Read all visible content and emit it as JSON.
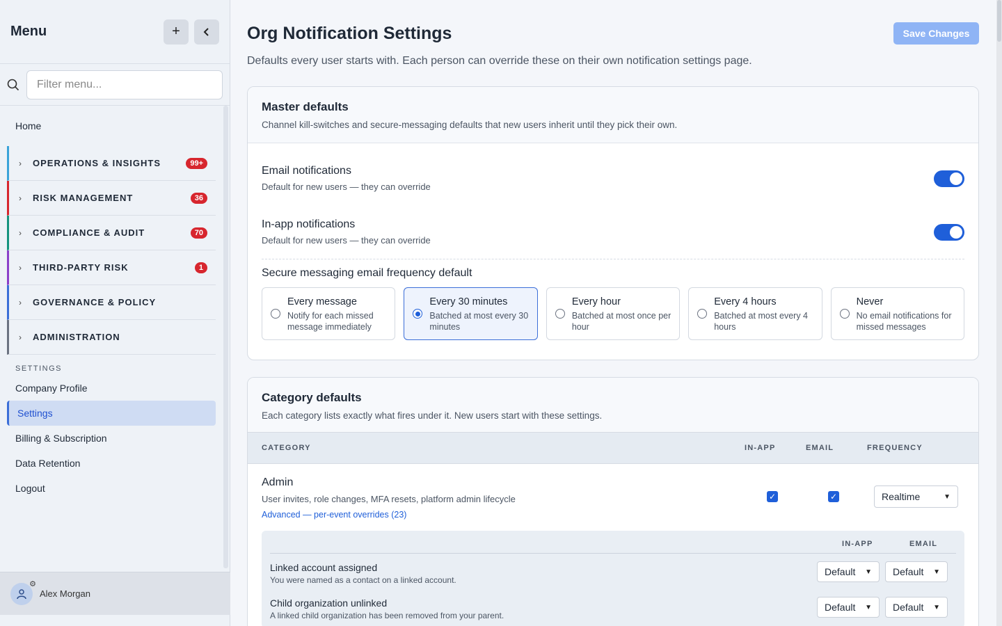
{
  "sidebar": {
    "title": "Menu",
    "add_icon": "plus-icon",
    "collapse_icon": "chevron-left-icon",
    "search_placeholder": "Filter menu...",
    "home": "Home",
    "groups": [
      {
        "label": "OPERATIONS & INSIGHTS",
        "badge": "99+",
        "color": "#3aa3d9"
      },
      {
        "label": "RISK MANAGEMENT",
        "badge": "36",
        "color": "#d7262e"
      },
      {
        "label": "COMPLIANCE & AUDIT",
        "badge": "70",
        "color": "#14937d"
      },
      {
        "label": "THIRD-PARTY RISK",
        "badge": "1",
        "color": "#8b3fc9"
      },
      {
        "label": "GOVERNANCE & POLICY",
        "badge": "",
        "color": "#3b6ed8"
      },
      {
        "label": "ADMINISTRATION",
        "badge": "",
        "color": "#6b7280"
      }
    ],
    "settings_label": "SETTINGS",
    "settings_items": [
      "Company Profile",
      "Settings",
      "Billing & Subscription",
      "Data Retention",
      "Logout"
    ],
    "user": "Alex Morgan"
  },
  "page": {
    "title": "Org Notification Settings",
    "subtitle": "Defaults every user starts with. Each person can override these on their own notification settings page.",
    "save_label": "Save Changes"
  },
  "master": {
    "title": "Master defaults",
    "desc": "Channel kill-switches and secure-messaging defaults that new users inherit until they pick their own.",
    "email_title": "Email notifications",
    "email_desc": "Default for new users — they can override",
    "inapp_title": "In-app notifications",
    "inapp_desc": "Default for new users — they can override",
    "freq_title": "Secure messaging email frequency default",
    "freq_options": [
      {
        "title": "Every message",
        "desc": "Notify for each missed message immediately",
        "selected": false
      },
      {
        "title": "Every 30 minutes",
        "desc": "Batched at most every 30 minutes",
        "selected": true
      },
      {
        "title": "Every hour",
        "desc": "Batched at most once per hour",
        "selected": false
      },
      {
        "title": "Every 4 hours",
        "desc": "Batched at most every 4 hours",
        "selected": false
      },
      {
        "title": "Never",
        "desc": "No email notifications for missed messages",
        "selected": false
      }
    ]
  },
  "category": {
    "title": "Category defaults",
    "desc": "Each category lists exactly what fires under it. New users start with these settings.",
    "col_category": "CATEGORY",
    "col_inapp": "IN-APP",
    "col_email": "EMAIL",
    "col_frequency": "FREQUENCY",
    "admin_title": "Admin",
    "admin_desc": "User invites, role changes, MFA resets, platform admin lifecycle",
    "admin_link": "Advanced — per-event overrides (23)",
    "admin_frequency": "Realtime",
    "adv_col_inapp": "IN-APP",
    "adv_col_email": "EMAIL",
    "events": [
      {
        "title": "Linked account assigned",
        "desc": "You were named as a contact on a linked account.",
        "inapp": "Default",
        "email": "Default"
      },
      {
        "title": "Child organization unlinked",
        "desc": "A linked child organization has been removed from your parent.",
        "inapp": "Default",
        "email": "Default"
      }
    ]
  }
}
